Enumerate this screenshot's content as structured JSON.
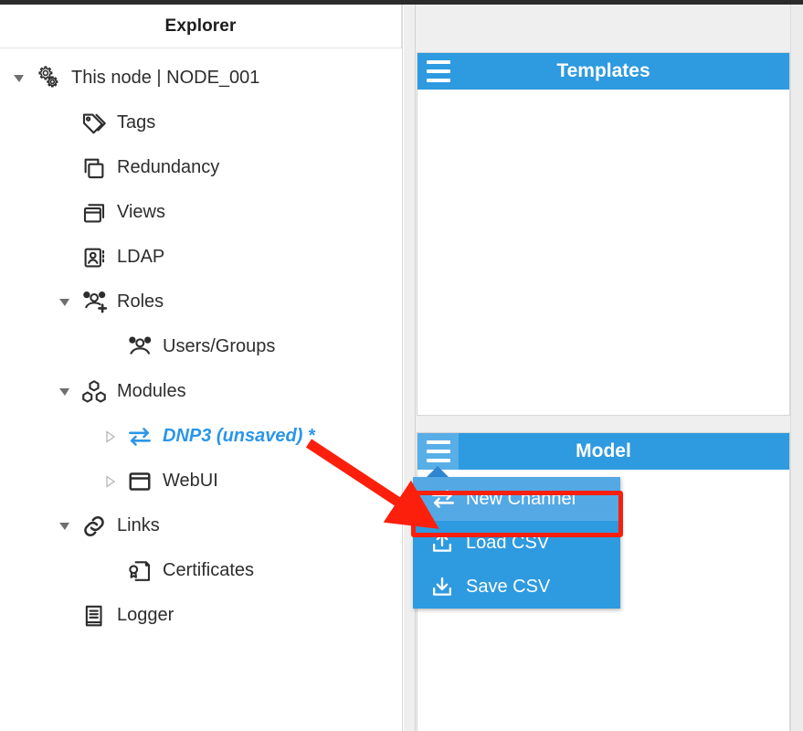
{
  "explorer": {
    "title": "Explorer",
    "tree": [
      {
        "label": "This node | NODE_001",
        "icon": "gears-icon",
        "level": 0,
        "twisty": "expanded",
        "accent": false
      },
      {
        "label": "Tags",
        "icon": "tags-icon",
        "level": 1,
        "twisty": "none",
        "accent": false
      },
      {
        "label": "Redundancy",
        "icon": "copy-icon",
        "level": 1,
        "twisty": "none",
        "accent": false
      },
      {
        "label": "Views",
        "icon": "window-icon",
        "level": 1,
        "twisty": "none",
        "accent": false
      },
      {
        "label": "LDAP",
        "icon": "id-card-icon",
        "level": 1,
        "twisty": "none",
        "accent": false
      },
      {
        "label": "Roles",
        "icon": "users-add-icon",
        "level": 1,
        "twisty": "expanded",
        "accent": false
      },
      {
        "label": "Users/Groups",
        "icon": "users-icon",
        "level": 2,
        "twisty": "none",
        "accent": false
      },
      {
        "label": "Modules",
        "icon": "cubes-icon",
        "level": 1,
        "twisty": "expanded",
        "accent": false
      },
      {
        "label": "DNP3 (unsaved) *",
        "icon": "exchange-icon",
        "level": 2,
        "twisty": "collapsed",
        "accent": true
      },
      {
        "label": "WebUI",
        "icon": "browser-icon",
        "level": 2,
        "twisty": "collapsed",
        "accent": false
      },
      {
        "label": "Links",
        "icon": "link-icon",
        "level": 1,
        "twisty": "expanded",
        "accent": false
      },
      {
        "label": "Certificates",
        "icon": "certificate-icon",
        "level": 2,
        "twisty": "none",
        "accent": false
      },
      {
        "label": "Logger",
        "icon": "book-icon",
        "level": 1,
        "twisty": "none",
        "accent": false
      }
    ]
  },
  "panels": {
    "templates": {
      "title": "Templates",
      "menu_icon": "hamburger-icon"
    },
    "model": {
      "title": "Model",
      "menu_icon": "hamburger-icon"
    }
  },
  "model_menu": {
    "items": [
      {
        "label": "New Channel",
        "icon": "exchange-icon",
        "highlighted": true
      },
      {
        "label": "Load CSV",
        "icon": "upload-icon",
        "highlighted": false
      },
      {
        "label": "Save CSV",
        "icon": "download-icon",
        "highlighted": false
      }
    ]
  },
  "annotation": {
    "arrow_color": "#fb1f0c",
    "highlight_color": "#fb1f0c"
  },
  "colors": {
    "panel_header_blue": "#2e9ae0",
    "menu_blue": "#2e9ae0",
    "menu_highlight_blue": "#54a9e4",
    "accent_text_blue": "#2a96e8"
  }
}
